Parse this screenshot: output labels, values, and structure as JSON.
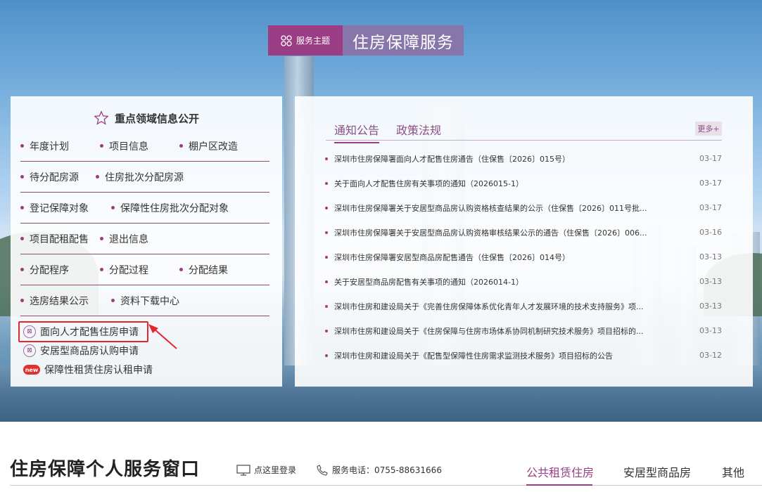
{
  "service_tag": {
    "icon": "grid-icon",
    "label": "服务主题",
    "title": "住房保障服务"
  },
  "key_info": {
    "title": "重点领域信息公开",
    "rows": [
      [
        "年度计划",
        "项目信息",
        "棚户区改造"
      ],
      [
        "待分配房源",
        "住房批次分配房源"
      ],
      [
        "登记保障对象",
        "保障性住房批次分配对象"
      ],
      [
        "项目配租配售",
        "退出信息"
      ],
      [
        "分配程序",
        "分配过程",
        "分配结果"
      ],
      [
        "选房结果公示",
        "资料下载中心"
      ]
    ],
    "applications": [
      {
        "label": "面向人才配售住房申请",
        "icon": "application-icon"
      },
      {
        "label": "安居型商品房认购申请",
        "icon": "application-icon"
      },
      {
        "label": "保障性租赁住房认租申请",
        "icon": "new-badge-icon",
        "badge": "new"
      }
    ]
  },
  "notices": {
    "tabs": [
      "通知公告",
      "政策法规"
    ],
    "more": "更多+",
    "items": [
      {
        "title": "深圳市住房保障署面向人才配售住房通告（住保售〔2026〕015号）",
        "date": "03-17"
      },
      {
        "title": "关于面向人才配售住房有关事项的通知（2026015-1）",
        "date": "03-17"
      },
      {
        "title": "深圳市住房保障署关于安居型商品房认购资格核查结果的公示（住保售〔2026〕011号批...",
        "date": "03-17"
      },
      {
        "title": "深圳市住房保障署关于安居型商品房认购资格审核结果公示的通告（住保售〔2026〕006...",
        "date": "03-16"
      },
      {
        "title": "深圳市住房保障署安居型商品房配售通告（住保售〔2026〕014号）",
        "date": "03-13"
      },
      {
        "title": "关于安居型商品房配售有关事项的通知（2026014-1）",
        "date": "03-13"
      },
      {
        "title": "深圳市住房和建设局关于《完善住房保障体系优化青年人才发展环境的技术支持服务》项...",
        "date": "03-13"
      },
      {
        "title": "深圳市住房和建设局关于《住房保障与住房市场体系协同机制研究技术服务》项目招标的...",
        "date": "03-13"
      },
      {
        "title": "深圳市住房和建设局关于《配售型保障性住房需求监测技术服务》项目招标的公告",
        "date": "03-12"
      }
    ]
  },
  "bottom": {
    "title": "住房保障个人服务窗口",
    "login": "点这里登录",
    "phone": "服务电话：0755-88631666",
    "tabs": [
      "公共租赁住房",
      "安居型商品房",
      "其他"
    ]
  },
  "colors": {
    "accent": "#9b3d85",
    "tag_right": "#8776aa",
    "highlight": "#e4262d"
  }
}
